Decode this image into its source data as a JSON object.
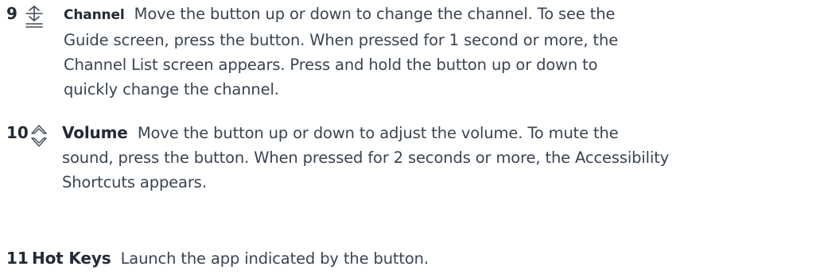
{
  "items": [
    {
      "number": "9",
      "icon": "channel-rocker-icon",
      "term": "Channel",
      "lines": [
        "Move the button up or down to change the channel. To see the",
        "Guide screen, press the button. When pressed for 1 second or more, the",
        "Channel List screen appears. Press and hold the button up or down to",
        "quickly change the channel."
      ]
    },
    {
      "number": "10",
      "icon": "volume-up-down-icon",
      "term": "Volume",
      "lines": [
        "Move the button up or down to adjust the volume. To mute the",
        "sound, press the button.  When pressed for 2 seconds or more, the Accessibility",
        "Shortcuts appears."
      ]
    },
    {
      "number": "11",
      "term": "Hot Keys",
      "lines": [
        "Launch the app indicated by the button."
      ]
    }
  ]
}
